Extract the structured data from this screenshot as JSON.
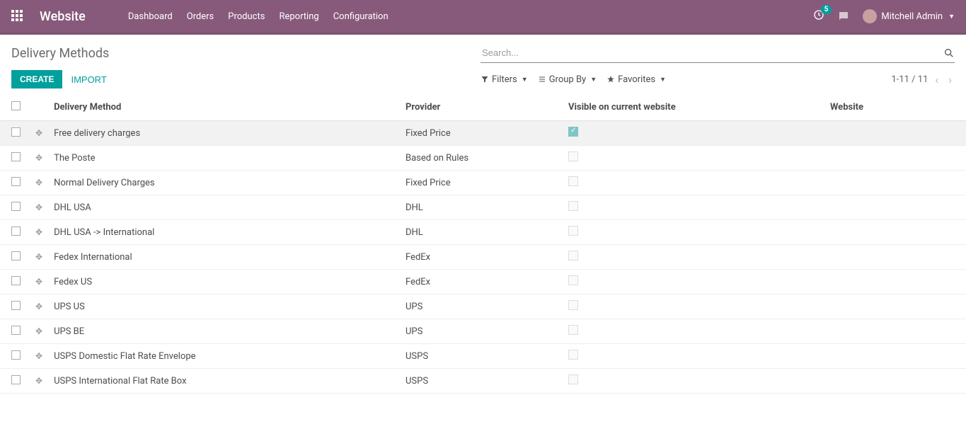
{
  "topbar": {
    "brand": "Website",
    "menu": [
      "Dashboard",
      "Orders",
      "Products",
      "Reporting",
      "Configuration"
    ],
    "badge": "5",
    "user": "Mitchell Admin"
  },
  "breadcrumb": "Delivery Methods",
  "search": {
    "placeholder": "Search...",
    "value": ""
  },
  "buttons": {
    "create": "CREATE",
    "import": "IMPORT"
  },
  "filters": {
    "filters": "Filters",
    "groupby": "Group By",
    "favorites": "Favorites"
  },
  "pager": "1-11 / 11",
  "columns": {
    "method": "Delivery Method",
    "provider": "Provider",
    "visible": "Visible on current website",
    "website": "Website"
  },
  "rows": [
    {
      "method": "Free delivery charges",
      "provider": "Fixed Price",
      "visible": true,
      "website": ""
    },
    {
      "method": "The Poste",
      "provider": "Based on Rules",
      "visible": false,
      "website": ""
    },
    {
      "method": "Normal Delivery Charges",
      "provider": "Fixed Price",
      "visible": false,
      "website": ""
    },
    {
      "method": "DHL USA",
      "provider": "DHL",
      "visible": false,
      "website": ""
    },
    {
      "method": "DHL USA -> International",
      "provider": "DHL",
      "visible": false,
      "website": ""
    },
    {
      "method": "Fedex International",
      "provider": "FedEx",
      "visible": false,
      "website": ""
    },
    {
      "method": "Fedex US",
      "provider": "FedEx",
      "visible": false,
      "website": ""
    },
    {
      "method": "UPS US",
      "provider": "UPS",
      "visible": false,
      "website": ""
    },
    {
      "method": "UPS BE",
      "provider": "UPS",
      "visible": false,
      "website": ""
    },
    {
      "method": "USPS Domestic Flat Rate Envelope",
      "provider": "USPS",
      "visible": false,
      "website": ""
    },
    {
      "method": "USPS International Flat Rate Box",
      "provider": "USPS",
      "visible": false,
      "website": ""
    }
  ]
}
